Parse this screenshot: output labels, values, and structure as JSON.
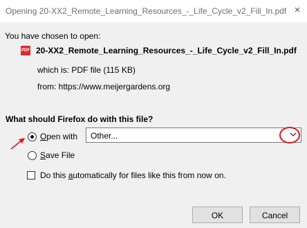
{
  "window": {
    "title": "Opening 20-XX2_Remote_Learning_Resources_-_Life_Cycle_v2_Fill_In.pdf",
    "close_glyph": "×"
  },
  "dialog": {
    "chosen_label": "You have chosen to open:",
    "file_icon_text": "PDF",
    "filename": "20-XX2_Remote_Learning_Resources_-_Life_Cycle_v2_Fill_In.pdf",
    "which_is": "which is: PDF file (115 KB)",
    "from": "from: https://www.meijergardens.org",
    "question": "What should Firefox do with this file?",
    "open_with": {
      "pre": "",
      "accel": "O",
      "post": "pen with",
      "selected": true
    },
    "open_with_select": {
      "value": "Other..."
    },
    "save_file": {
      "accel": "S",
      "post": "ave File",
      "selected": false
    },
    "auto": {
      "pre": "Do this ",
      "accel": "a",
      "post": "utomatically for files like this from now on.",
      "checked": false
    },
    "ok_label": "OK",
    "cancel_label": "Cancel"
  },
  "colors": {
    "annotation": "#e01616",
    "pdf_icon": "#d92b2b"
  },
  "icons": {
    "file": "pdf-file-icon",
    "dropdown": "chevron-down-icon",
    "close": "close-icon"
  }
}
